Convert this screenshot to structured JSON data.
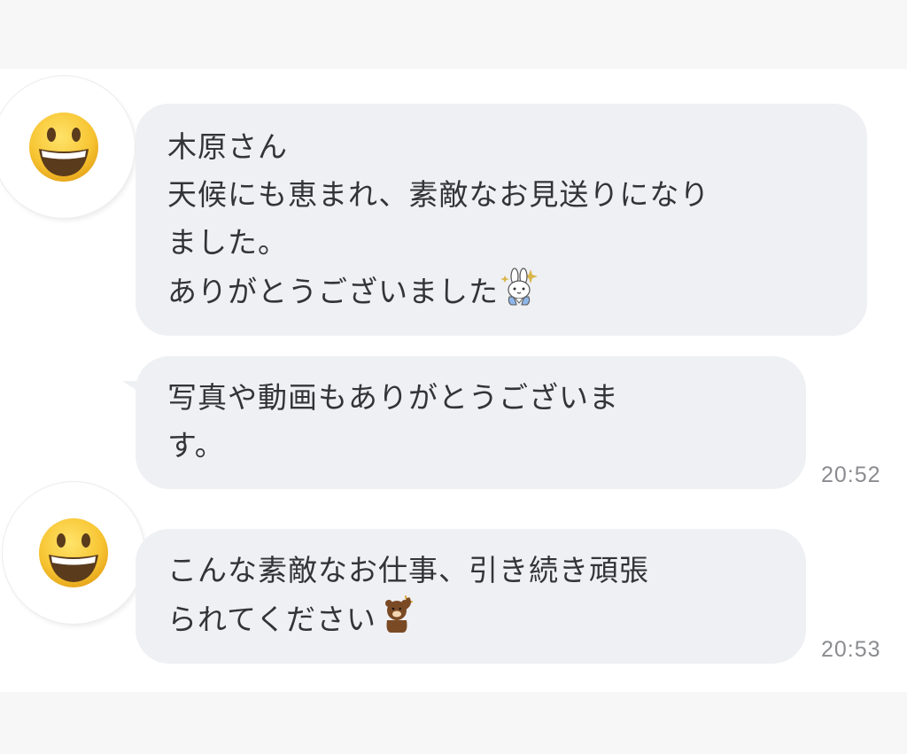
{
  "messages": [
    {
      "sender_avatar": "smiley-face-avatar",
      "lines": [
        "木原さん",
        "天候にも恵まれ、素敵なお見送りになり",
        "ました。",
        "ありがとうございました"
      ],
      "trailing_sticker": "bunny-sparkle-sticker"
    },
    {
      "lines": [
        "写真や動画もありがとうございま",
        "す。"
      ],
      "time": "20:52"
    },
    {
      "sender_avatar": "smiley-face-avatar",
      "lines": [
        "こんな素敵なお仕事、引き続き頑張",
        "られてください"
      ],
      "trailing_sticker": "bear-cheer-sticker",
      "time": "20:53"
    }
  ],
  "colors": {
    "bubble": "#eff0f3",
    "text": "#333438",
    "timestamp": "#8b8c90",
    "background": "#ffffff",
    "frame": "#f7f7f8"
  }
}
